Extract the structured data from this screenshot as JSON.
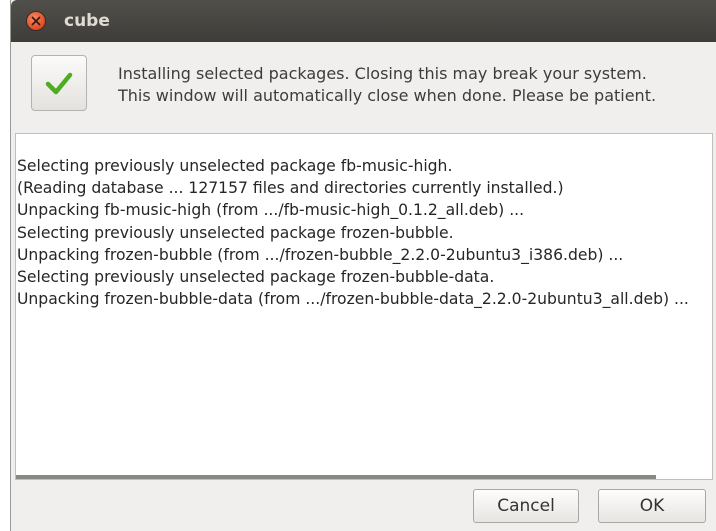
{
  "window": {
    "title": "cube",
    "close_icon": "close-icon",
    "accent_close_color": "#df4b22"
  },
  "status": {
    "icon": "checkmark-icon",
    "icon_color": "#4eac1f",
    "line1": "Installing selected packages. Closing this may break your system.",
    "line2": "This window will automatically close when done. Please be patient."
  },
  "log": {
    "lines": [
      "Selecting previously unselected package fb-music-high.",
      "(Reading database ... 127157 files and directories currently installed.)",
      "Unpacking fb-music-high (from .../fb-music-high_0.1.2_all.deb) ...",
      "Selecting previously unselected package frozen-bubble.",
      "Unpacking frozen-bubble (from .../frozen-bubble_2.2.0-2ubuntu3_i386.deb) ...",
      "Selecting previously unselected package frozen-bubble-data.",
      "Unpacking frozen-bubble-data (from .../frozen-bubble-data_2.2.0-2ubuntu3_all.deb) ..."
    ]
  },
  "buttons": {
    "cancel_label": "Cancel",
    "ok_label": "OK"
  }
}
